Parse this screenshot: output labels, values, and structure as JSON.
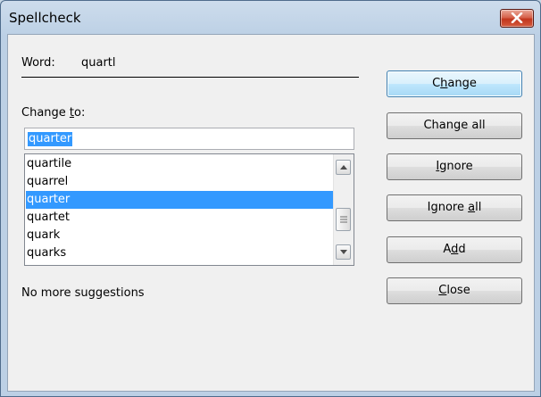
{
  "window": {
    "title": "Spellcheck"
  },
  "word": {
    "label": "Word:",
    "value": "quartl"
  },
  "change_to": {
    "label_pre": "Change ",
    "label_accel": "t",
    "label_post": "o:",
    "value": "quarter"
  },
  "suggestions": {
    "items": [
      "quartile",
      "quarrel",
      "quarter",
      "quartet",
      "quark",
      "quarks"
    ],
    "selected_index": 2
  },
  "status": "No more suggestions",
  "buttons": {
    "change": {
      "pre": "C",
      "accel": "h",
      "post": "ange"
    },
    "change_all": {
      "pre": "Chan",
      "accel": "g",
      "post": "e all"
    },
    "ignore": {
      "pre": "",
      "accel": "I",
      "post": "gnore"
    },
    "ignore_all": {
      "pre": "Ignore ",
      "accel": "a",
      "post": "ll"
    },
    "add": {
      "pre": "A",
      "accel": "d",
      "post": "d"
    },
    "close": {
      "pre": "",
      "accel": "C",
      "post": "lose"
    }
  },
  "icons": {
    "close": "close-icon",
    "scroll_up": "arrow-up-icon",
    "scroll_down": "arrow-down-icon",
    "scroll_grip": "grip-icon"
  }
}
